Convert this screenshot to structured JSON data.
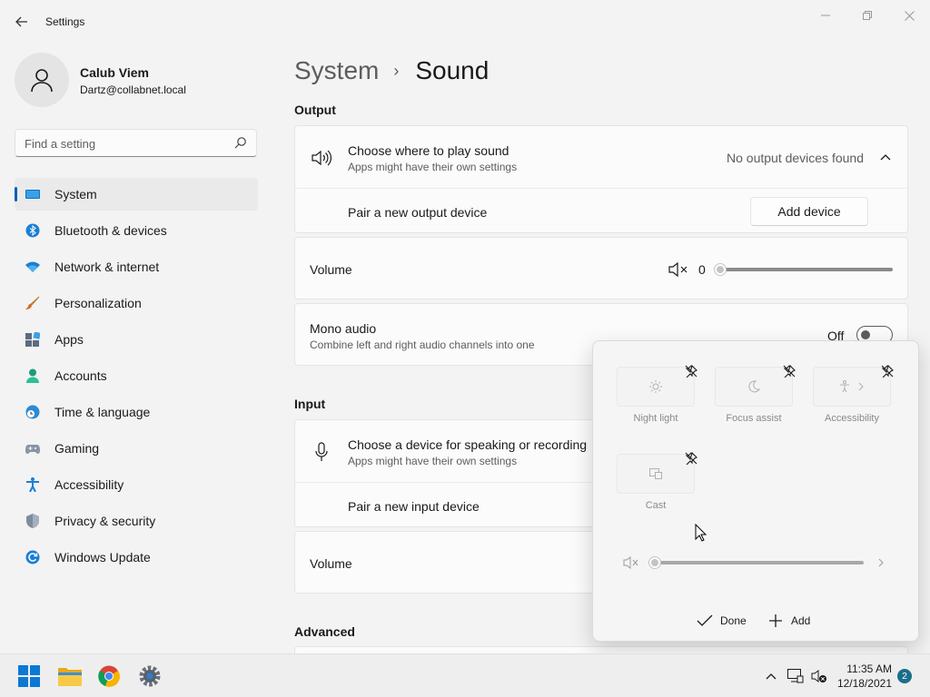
{
  "window": {
    "title": "Settings",
    "back_icon": "back-arrow-icon",
    "minimize_icon": "minimize-icon",
    "restore_icon": "restore-icon",
    "close_icon": "close-icon"
  },
  "user": {
    "name": "Calub Viem",
    "email": "Dartz@collabnet.local",
    "avatar_icon": "person-icon"
  },
  "search": {
    "placeholder": "Find a setting",
    "icon": "search-icon"
  },
  "sidebar": {
    "items": [
      {
        "label": "System",
        "icon": "monitor-icon",
        "active": true
      },
      {
        "label": "Bluetooth & devices",
        "icon": "bluetooth-icon"
      },
      {
        "label": "Network & internet",
        "icon": "wifi-icon"
      },
      {
        "label": "Personalization",
        "icon": "brush-icon"
      },
      {
        "label": "Apps",
        "icon": "apps-icon"
      },
      {
        "label": "Accounts",
        "icon": "account-icon"
      },
      {
        "label": "Time & language",
        "icon": "globe-clock-icon"
      },
      {
        "label": "Gaming",
        "icon": "gamepad-icon"
      },
      {
        "label": "Accessibility",
        "icon": "accessibility-icon"
      },
      {
        "label": "Privacy & security",
        "icon": "shield-icon"
      },
      {
        "label": "Windows Update",
        "icon": "update-icon"
      }
    ]
  },
  "breadcrumb": {
    "parent": "System",
    "separator": "›",
    "current": "Sound"
  },
  "output": {
    "section_title": "Output",
    "choose_title": "Choose where to play sound",
    "choose_sub": "Apps might have their own settings",
    "status": "No output devices found",
    "pair_label": "Pair a new output device",
    "add_device_label": "Add device",
    "volume_label": "Volume",
    "volume_value": "0",
    "volume_level": 0,
    "mono_title": "Mono audio",
    "mono_sub": "Combine left and right audio channels into one",
    "mono_state": "Off"
  },
  "input": {
    "section_title": "Input",
    "choose_title": "Choose a device for speaking or recording",
    "choose_sub": "Apps might have their own settings",
    "pair_label": "Pair a new input device",
    "volume_label": "Volume"
  },
  "advanced": {
    "section_title": "Advanced"
  },
  "quick_settings": {
    "tiles": [
      {
        "label": "Night light",
        "icon": "brightness-icon"
      },
      {
        "label": "Focus assist",
        "icon": "moon-icon"
      },
      {
        "label": "Accessibility",
        "icon": "accessibility-icon"
      },
      {
        "label": "Cast",
        "icon": "cast-icon"
      }
    ],
    "volume_level": 0,
    "done_label": "Done",
    "add_label": "Add"
  },
  "taskbar": {
    "apps": [
      "windows-start-icon",
      "file-explorer-icon",
      "chrome-icon",
      "settings-icon"
    ],
    "time": "11:35 AM",
    "date": "12/18/2021",
    "notifications": "2"
  }
}
